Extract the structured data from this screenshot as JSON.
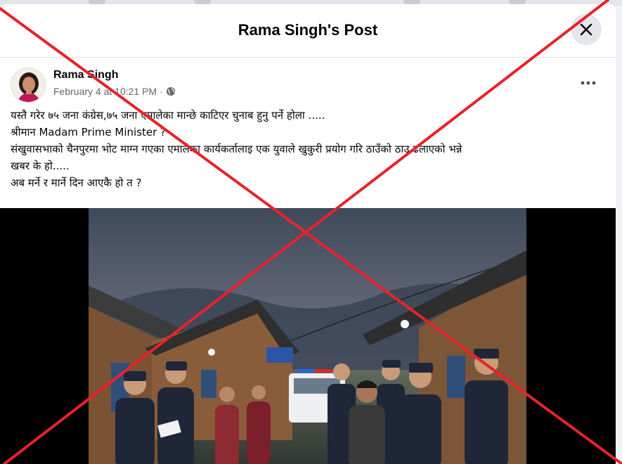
{
  "background_nav": {
    "icons": [
      "home-icon",
      "video-icon",
      "marketplace-icon",
      "gaming-icon"
    ]
  },
  "dialog": {
    "title": "Rama Singh's Post",
    "close_icon": "close-icon"
  },
  "post": {
    "author": "Rama Singh",
    "timestamp": "February 4 at 10:21 PM",
    "separator": "·",
    "privacy_icon": "globe-icon",
    "more_icon": "more-horizontal-icon",
    "text_lines": [
      "यस्तै गरेर ७५ जना कंग्रेस,७५ जना एमालेका मान्छे काटिएर चुनाब हुनु पर्ने होला .....",
      "श्रीमान Madam Prime Minister ?",
      "संखुवासभाको चैनपुरमा भोट माग्न गएका एमालेका कार्यकर्तालाइ एक युवाले खुकुरी प्रयोग गरि ठाउँको ठाउ ढलाएको भन्ने",
      "खबर के हो.....",
      "अब मर्ने र मार्ने दिन आएकै हो त ?"
    ]
  },
  "overlay": {
    "mark": "red-x-cross",
    "color": "#e8222a"
  }
}
